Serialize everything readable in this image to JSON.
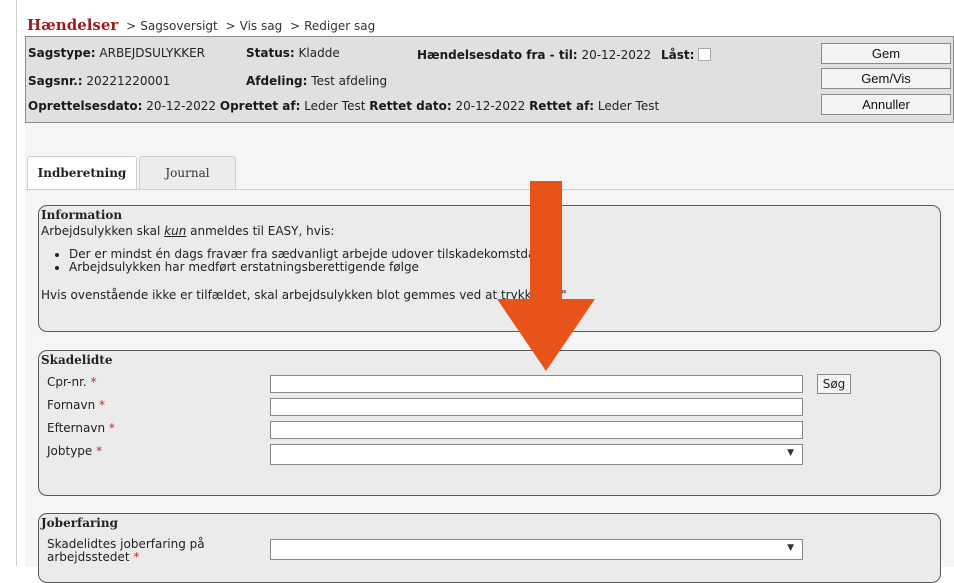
{
  "breadcrumb": {
    "app": "Hændelser",
    "separators": [
      ">",
      ">",
      ">"
    ],
    "items": [
      "Sagsoversigt",
      "Vis sag",
      "Rediger sag"
    ]
  },
  "header": {
    "sagstype": {
      "label": "Sagstype:",
      "value": "ARBEJDSULYKKER"
    },
    "status": {
      "label": "Status:",
      "value": "Kladde"
    },
    "dato_range": {
      "label": "Hændelsesdato fra - til:",
      "value": "20-12-2022"
    },
    "laast": {
      "label": "Låst:"
    },
    "sagsnr": {
      "label": "Sagsnr.:",
      "value": "20221220001"
    },
    "afdeling": {
      "label": "Afdeling:",
      "value": "Test afdeling"
    },
    "oprettelsesdato": {
      "label": "Oprettelsesdato:",
      "value": "20-12-2022"
    },
    "oprettet_af": {
      "label": "Oprettet af:",
      "value": "Leder Test"
    },
    "rettet_dato": {
      "label": "Rettet dato:",
      "value": "20-12-2022"
    },
    "rettet_af": {
      "label": "Rettet af:",
      "value": "Leder Test"
    },
    "buttons": {
      "gem": "Gem",
      "gem_vis": "Gem/Vis",
      "annuller": "Annuller"
    }
  },
  "tabs": [
    {
      "label": "Indberetning",
      "active": true
    },
    {
      "label": "Journal",
      "active": false
    }
  ],
  "information": {
    "title": "Information",
    "intro_pre": "Arbejdsulykken skal ",
    "intro_em": "kun",
    "intro_post": " anmeldes til EASY, hvis:",
    "bullets": [
      "Der er mindst én dags fravær fra sædvanligt arbejde udover tilskadekomstdagen",
      "Arbejdsulykken har medført erstatningsberettigende følge"
    ],
    "footer": "Hvis ovenstående ikke er tilfældet, skal arbejdsulykken blot gemmes ved at trykke på \""
  },
  "skadelidte": {
    "title": "Skadelidte",
    "fields": {
      "cpr": {
        "label": "Cpr-nr.",
        "value": ""
      },
      "fornavn": {
        "label": "Fornavn",
        "value": ""
      },
      "efternavn": {
        "label": "Efternavn",
        "value": ""
      },
      "jobtype": {
        "label": "Jobtype",
        "value": ""
      }
    },
    "required_mark": "*",
    "search_button": "Søg"
  },
  "joberfaring": {
    "title": "Joberfaring",
    "field_label_line1": "Skadelidtes joberfaring på",
    "field_label_line2": "arbejdsstedet",
    "required_mark": "*",
    "value": ""
  },
  "colors": {
    "brand": "#a11b1b",
    "arrow": "#e8531a",
    "required": "#dd2222",
    "header_bg": "#e0e0e0"
  }
}
